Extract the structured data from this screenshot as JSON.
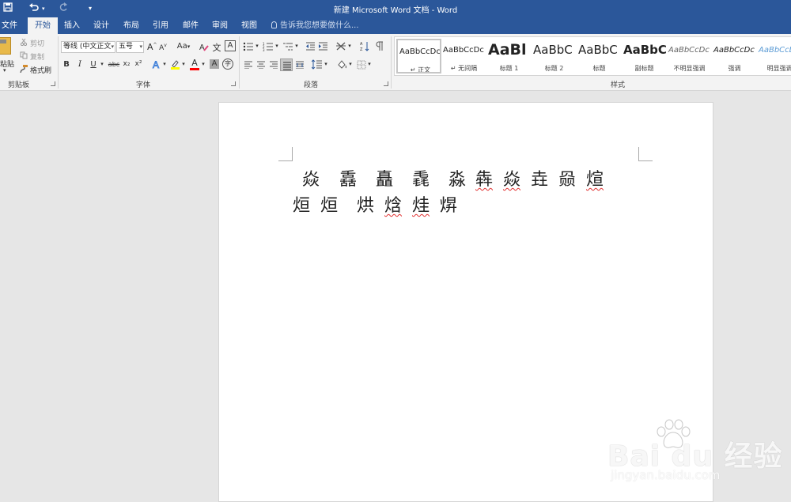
{
  "window": {
    "title": "新建 Microsoft Word 文档 - Word",
    "quick_access": [
      "save-icon",
      "undo-icon",
      "redo-icon",
      "customize-icon"
    ]
  },
  "tabs": [
    "文件",
    "开始",
    "插入",
    "设计",
    "布局",
    "引用",
    "邮件",
    "审阅",
    "视图"
  ],
  "active_tab": "开始",
  "tell_me": "告诉我您想要做什么...",
  "clipboard": {
    "paste": "粘贴",
    "cut": "剪切",
    "copy": "复制",
    "format_painter": "格式刷",
    "label": "剪贴板"
  },
  "font": {
    "name": "等线 (中文正文",
    "size": "五号",
    "label": "字体",
    "change_case": "Aa",
    "bold": "B",
    "italic": "I",
    "underline": "U",
    "strikethrough": "abc",
    "subscript": "x₂",
    "superscript": "x²",
    "font_color": "A",
    "phonetic": "文",
    "char_border": "A",
    "enclose": "字",
    "grow": "A",
    "shrink": "A",
    "highlight_color": "#ffff00",
    "font_color_value": "#ff0000"
  },
  "paragraph": {
    "label": "段落"
  },
  "styles": {
    "label": "样式",
    "items": [
      {
        "sample": "AaBbCcDc",
        "name": "↵ 正文"
      },
      {
        "sample": "AaBbCcDc",
        "name": "↵ 无间隔"
      },
      {
        "sample": "AaBl",
        "name": "标题 1"
      },
      {
        "sample": "AaBbC",
        "name": "标题 2"
      },
      {
        "sample": "AaBbC",
        "name": "标题"
      },
      {
        "sample": "AaBbC",
        "name": "副标题"
      },
      {
        "sample": "AaBbCcDc",
        "name": "不明显强调"
      },
      {
        "sample": "AaBbCcDc",
        "name": "强调"
      },
      {
        "sample": "AaBbCcDc",
        "name": "明显强调"
      }
    ]
  },
  "document": {
    "line1": [
      "焱",
      "舙",
      "矗",
      "毳",
      "淼",
      "犇",
      "焱",
      "垚",
      "赑",
      "煊"
    ],
    "line2": [
      "烜",
      "烜",
      "烘",
      "焓",
      "烓",
      "焺"
    ]
  },
  "watermark": {
    "brand": "Bai du 经验",
    "url": "jingyan.baidu.com"
  }
}
